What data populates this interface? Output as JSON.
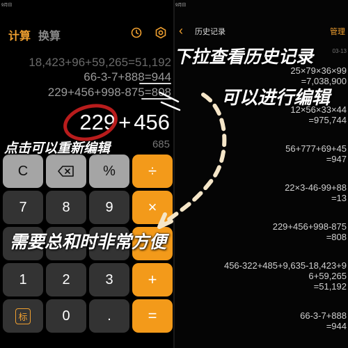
{
  "status": {
    "left": "9月日",
    "right": "9月日"
  },
  "calculator": {
    "tab_calc": "计算",
    "tab_convert": "换算",
    "history_lines": [
      "18,423+96+59,265=51,192",
      "66-3-7+888=944",
      "229+456+998-875=808"
    ],
    "expr_left": "229",
    "expr_op": "+",
    "expr_right": "456",
    "ghost_result": "685",
    "keys": {
      "clear": "C",
      "percent": "%",
      "divide": "÷",
      "k7": "7",
      "k8": "8",
      "k9": "9",
      "multiply": "×",
      "k1": "1",
      "k2": "2",
      "k3": "3",
      "plus": "+",
      "mode": "标",
      "k0": "0",
      "dot": ".",
      "equals": "="
    }
  },
  "history_panel": {
    "back": "‹",
    "title": "历史记录",
    "manage": "管理",
    "date": "03-13",
    "records": [
      {
        "expr": "25×79×36×99",
        "result": "=7,038,900"
      },
      {
        "expr": "12×56×33×44",
        "result": "=975,744"
      },
      {
        "expr": "56+777+69+45",
        "result": "=947"
      },
      {
        "expr": "22×3-46-99+88",
        "result": "=13"
      },
      {
        "expr": "229+456+998-875",
        "result": "=808"
      },
      {
        "expr": "456-322+485+9,635-18,423+9\n6+59,265",
        "result": "=51,192"
      },
      {
        "expr": "66-3-7+888",
        "result": "=944"
      }
    ]
  },
  "annotations": {
    "pull": "下拉查看历史记录",
    "edit": "可以进行编辑",
    "click": "点击可以重新编辑",
    "sum": "需要总和时非常方便"
  },
  "colors": {
    "accent": "#f39a1a",
    "tab_active": "#f0a030",
    "gray_key": "#a5a5a5",
    "dark_key": "#333333",
    "circle": "#b81c1c"
  }
}
